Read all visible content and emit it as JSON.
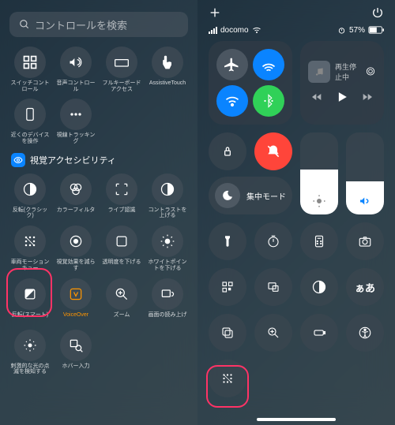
{
  "left": {
    "search_placeholder": "コントロールを検索",
    "row1": [
      "スイッチコントロール",
      "音声コントロール",
      "フルキーボードアクセス",
      "AssistiveTouch"
    ],
    "row2": [
      "近くのデバイスを操作",
      "視線トラッキング"
    ],
    "section": "視覚アクセシビリティ",
    "row3": [
      "反転(クラシック)",
      "カラーフィルタ",
      "ライブ認識",
      "コントラストを上げる"
    ],
    "row4": [
      "車両モーションキュー",
      "視覚効果を減らす",
      "透明度を下げる",
      "ホワイトポイントを下げる"
    ],
    "row5": [
      "反転(スマート)",
      "VoiceOver",
      "ズーム",
      "画面の読み上げ"
    ],
    "row6": [
      "刺激的な光の点滅を検知する",
      "ホバー入力"
    ]
  },
  "right": {
    "carrier": "docomo",
    "battery": "57%",
    "media_status": "再生停止中",
    "focus_label": "集中モード",
    "brightness_pct": 55,
    "volume_pct": 40
  }
}
